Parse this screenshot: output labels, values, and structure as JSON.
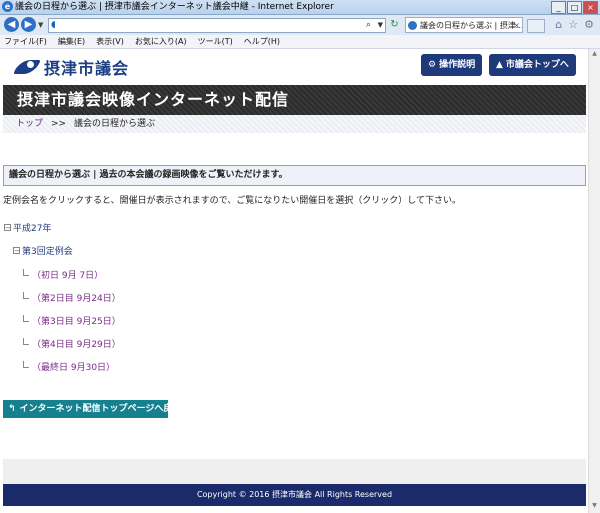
{
  "browser": {
    "window_title": "議会の日程から選ぶ | 摂津市議会インターネット議会中継 - Internet Explorer",
    "tab_title": "議会の日程から選ぶ | 摂津...",
    "menu": [
      "ファイル(F)",
      "編集(E)",
      "表示(V)",
      "お気に入り(A)",
      "ツール(T)",
      "ヘルプ(H)"
    ]
  },
  "header": {
    "logo_text": "摂津市議会",
    "btn_help": "操作説明",
    "btn_top": "市議会トップへ"
  },
  "banner": {
    "title": "摂津市議会映像インターネット配信"
  },
  "breadcrumb": {
    "home": "トップ",
    "sep": ">>",
    "current": "議会の日程から選ぶ"
  },
  "section": {
    "heading": "議会の日程から選ぶ | 過去の本会議の録画映像をご覧いただけます。"
  },
  "description": "定例会名をクリックすると、開催日が表示されますので、ご覧になりたい開催日を選択（クリック）して下さい。",
  "tree": {
    "year": "平成27年",
    "session": "第3回定例会",
    "days": [
      "（初日 9月 7日）",
      "（第2日目 9月24日）",
      "（第3日目 9月25日）",
      "（第4日目 9月29日）",
      "（最終日 9月30日）"
    ]
  },
  "back_button": "インターネット配信トップページへ戻る",
  "footer": {
    "copyright": "Copyright © 2016 摂津市議会 All Rights Reserved"
  }
}
